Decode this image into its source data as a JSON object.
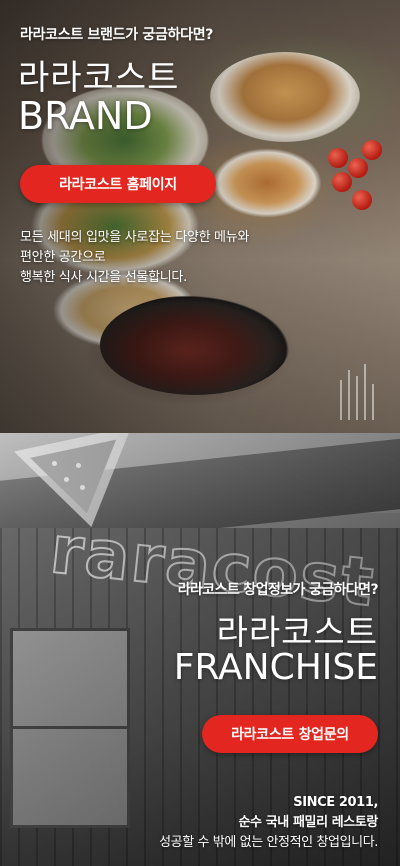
{
  "brand": {
    "question": "라라코스트 브랜드가 궁금하다면?",
    "title_ko": "라라코스트",
    "title_en": "BRAND",
    "button_label": "라라코스트 홈페이지",
    "description": [
      "모든 세대의 입맛을 사로잡는 다양한 메뉴와",
      "편안한 공간으로",
      "행복한 식사 시간을 선물합니다."
    ]
  },
  "franchise": {
    "question": "라라코스트 창업정보가 궁금하다면?",
    "title_ko": "라라코스트",
    "title_en": "FRANCHISE",
    "button_label": "라라코스트 창업문의",
    "description": [
      "SINCE 2011,",
      "순수 국내 패밀리 레스토랑",
      "성공할 수 밖에 없는 안정적인 창업입니다."
    ]
  },
  "colors": {
    "button_red": "#e3261f",
    "text": "#ffffff"
  }
}
